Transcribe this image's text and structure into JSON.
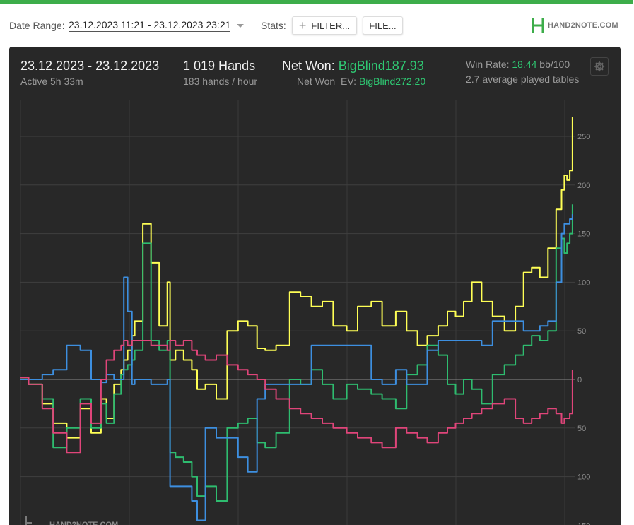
{
  "toolbar": {
    "date_range_label": "Date Range:",
    "date_range_value": "23.12.2023 11:21 - 23.12.2023 23:21",
    "stats_label": "Stats:",
    "filter_button": "FILTER...",
    "file_button": "FILE...",
    "logo_text": "HAND2NOTE.COM"
  },
  "summary": {
    "date": "23.12.2023 - 23.12.2023",
    "active": "Active 5h 33m",
    "hands": "1 019 Hands",
    "hands_per_hour": "183 hands / hour",
    "net_won_label": "Net Won:",
    "net_won_value": "BigBlind187.93",
    "net_won_ev_label": "Net Won  EV:",
    "net_won_ev_value": "BigBlind272.20",
    "win_rate_label": "Win Rate:",
    "win_rate_value": "18.44",
    "win_rate_unit": "bb/100",
    "tables": "2.7 average played tables"
  },
  "colors": {
    "accent": "#3dad4a",
    "panel_bg": "#282828",
    "net_won": "#2fc973",
    "yellow": "#ffff55",
    "green": "#2ebc6f",
    "blue": "#3d8fe0",
    "pink": "#e0457a"
  },
  "chart_data": {
    "type": "line",
    "xlim": [
      0,
      1019
    ],
    "ylim": [
      -150,
      275
    ],
    "y_ticks": [
      250,
      200,
      150,
      100,
      50,
      0,
      -50,
      -100,
      -150
    ],
    "y_tick_labels": [
      "250",
      "200",
      "150",
      "100",
      "50",
      "0",
      "50",
      "100",
      "150"
    ],
    "grid": true,
    "watermark": "HAND2NOTE.COM",
    "series": [
      {
        "color": "#ffff55",
        "x": [
          0,
          15,
          40,
          60,
          85,
          110,
          130,
          148,
          158,
          172,
          185,
          190,
          197,
          205,
          210,
          225,
          240,
          255,
          270,
          275,
          285,
          300,
          315,
          325,
          340,
          360,
          380,
          400,
          418,
          435,
          450,
          470,
          495,
          515,
          535,
          555,
          575,
          600,
          620,
          645,
          665,
          690,
          710,
          730,
          748,
          768,
          785,
          800,
          815,
          830,
          848,
          868,
          890,
          910,
          925,
          940,
          955,
          970,
          985,
          995,
          1000,
          1005,
          1010,
          1015
        ],
        "y": [
          2,
          -5,
          -25,
          -45,
          -60,
          -30,
          -55,
          -20,
          -40,
          -5,
          10,
          20,
          30,
          45,
          60,
          160,
          120,
          55,
          100,
          20,
          30,
          20,
          10,
          -10,
          -5,
          -20,
          50,
          60,
          55,
          32,
          30,
          35,
          90,
          85,
          75,
          80,
          55,
          50,
          75,
          80,
          55,
          70,
          50,
          35,
          45,
          55,
          70,
          65,
          80,
          100,
          80,
          65,
          50,
          75,
          110,
          115,
          105,
          135,
          175,
          195,
          210,
          205,
          215,
          270
        ]
      },
      {
        "color": "#2ebc6f",
        "x": [
          0,
          15,
          40,
          60,
          85,
          110,
          130,
          148,
          158,
          172,
          185,
          190,
          197,
          205,
          210,
          225,
          240,
          255,
          270,
          275,
          285,
          300,
          315,
          325,
          340,
          360,
          380,
          400,
          418,
          435,
          450,
          470,
          495,
          515,
          535,
          555,
          575,
          600,
          620,
          645,
          665,
          690,
          710,
          730,
          748,
          768,
          785,
          800,
          815,
          830,
          848,
          868,
          890,
          910,
          925,
          940,
          955,
          970,
          985,
          995,
          1000,
          1005,
          1010,
          1015
        ],
        "y": [
          2,
          -5,
          -20,
          -70,
          -50,
          -20,
          -50,
          -25,
          -45,
          -15,
          5,
          10,
          15,
          20,
          30,
          140,
          40,
          30,
          40,
          -75,
          -80,
          -85,
          -100,
          -120,
          -110,
          -125,
          -50,
          -45,
          -40,
          -65,
          -70,
          -55,
          0,
          -5,
          10,
          -5,
          -20,
          -5,
          -10,
          -15,
          -20,
          -30,
          5,
          15,
          35,
          25,
          -5,
          -15,
          0,
          -10,
          -25,
          5,
          15,
          25,
          35,
          45,
          40,
          50,
          135,
          145,
          130,
          140,
          150,
          180
        ]
      },
      {
        "color": "#3d8fe0",
        "x": [
          0,
          15,
          40,
          60,
          85,
          110,
          130,
          148,
          158,
          172,
          185,
          190,
          197,
          205,
          210,
          225,
          240,
          255,
          270,
          275,
          285,
          300,
          315,
          325,
          340,
          360,
          380,
          400,
          418,
          435,
          450,
          470,
          495,
          515,
          535,
          555,
          575,
          600,
          620,
          645,
          665,
          690,
          710,
          730,
          748,
          768,
          785,
          800,
          815,
          830,
          848,
          868,
          890,
          910,
          925,
          940,
          955,
          970,
          985,
          995,
          1000,
          1005,
          1010,
          1015
        ],
        "y": [
          0,
          0,
          5,
          10,
          35,
          30,
          0,
          -3,
          5,
          0,
          0,
          105,
          70,
          -5,
          0,
          0,
          -5,
          -5,
          0,
          -110,
          -110,
          -110,
          -125,
          -145,
          -50,
          -60,
          -60,
          -80,
          -95,
          -20,
          -5,
          -5,
          -5,
          -5,
          35,
          35,
          35,
          35,
          35,
          0,
          -5,
          10,
          -5,
          -5,
          30,
          40,
          40,
          40,
          40,
          40,
          35,
          60,
          60,
          60,
          50,
          50,
          55,
          60,
          100,
          150,
          160,
          160,
          165,
          170
        ]
      },
      {
        "color": "#e0457a",
        "x": [
          0,
          15,
          40,
          60,
          85,
          110,
          130,
          148,
          158,
          172,
          185,
          190,
          197,
          205,
          210,
          225,
          240,
          255,
          270,
          275,
          285,
          300,
          315,
          325,
          340,
          360,
          380,
          400,
          418,
          435,
          450,
          470,
          495,
          515,
          535,
          555,
          575,
          600,
          620,
          645,
          665,
          690,
          710,
          730,
          748,
          768,
          785,
          800,
          815,
          830,
          848,
          868,
          890,
          910,
          925,
          940,
          955,
          970,
          985,
          995,
          1000,
          1005,
          1010,
          1015
        ],
        "y": [
          2,
          -5,
          -30,
          -55,
          -75,
          -25,
          -45,
          0,
          20,
          30,
          35,
          40,
          35,
          40,
          40,
          40,
          35,
          35,
          30,
          40,
          35,
          40,
          30,
          25,
          20,
          25,
          15,
          10,
          5,
          0,
          -10,
          -20,
          -30,
          -35,
          -40,
          -45,
          -50,
          -55,
          -60,
          -65,
          -70,
          -50,
          -55,
          -60,
          -65,
          -55,
          -50,
          -45,
          -40,
          -35,
          -30,
          -25,
          -20,
          -40,
          -45,
          -40,
          -35,
          -30,
          -35,
          -45,
          -40,
          -40,
          -35,
          10
        ]
      }
    ]
  }
}
